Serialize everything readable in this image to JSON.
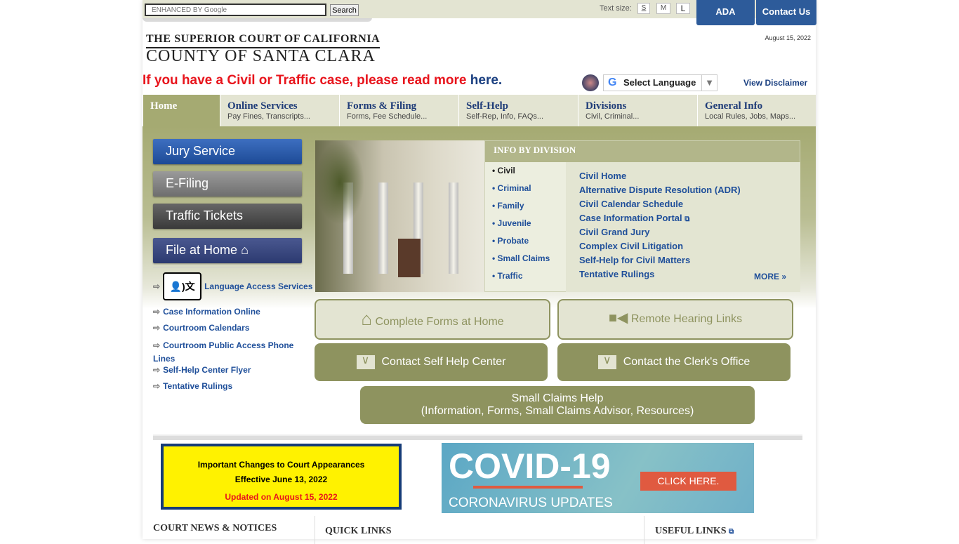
{
  "topbar": {
    "text_size_label": "Text size:",
    "sizes": [
      "S",
      "M",
      "L"
    ],
    "ada": "ADA",
    "contact": "Contact Us"
  },
  "header": {
    "logo_line1": "THE SUPERIOR COURT OF CALIFORNIA",
    "logo_line2": "COUNTY OF SANTA CLARA",
    "date": "August 15, 2022",
    "search_placeholder": "ENHANCED BY Google",
    "search_button": "Search",
    "alert_text": "If you have a Civil or Traffic case, please read more ",
    "alert_link": "here.",
    "language": "Select Language",
    "disclaimer": "View Disclaimer"
  },
  "nav": [
    {
      "title": "Home",
      "sub": ""
    },
    {
      "title": "Online Services",
      "sub": "Pay Fines, Transcripts..."
    },
    {
      "title": "Forms & Filing",
      "sub": "Forms, Fee Schedule..."
    },
    {
      "title": "Self-Help",
      "sub": "Self-Rep, Info, FAQs..."
    },
    {
      "title": "Divisions",
      "sub": "Civil, Criminal..."
    },
    {
      "title": "General Info",
      "sub": "Local Rules, Jobs, Maps..."
    }
  ],
  "left_buttons": [
    "Jury  Service",
    "E-Filing",
    "Traffic Tickets",
    "File at Home"
  ],
  "side_links": [
    "Language Access Services",
    "Case Information Online",
    "Courtroom Calendars",
    "Courtroom Public Access Phone Lines",
    "Self-Help Center Flyer",
    "Tentative Rulings"
  ],
  "info_by_division": {
    "title": "INFO BY DIVISION",
    "divisions": [
      "Civil",
      "Criminal",
      "Family",
      "Juvenile",
      "Probate",
      "Small Claims",
      "Traffic"
    ],
    "links": [
      "Civil Home",
      "Alternative Dispute Resolution (ADR)",
      "Civil Calendar Schedule",
      "Case Information Portal",
      "Civil Grand Jury",
      "Complex Civil Litigation",
      "Self-Help for Civil Matters",
      "Tentative Rulings"
    ],
    "more": "MORE »"
  },
  "action_buttons": {
    "forms": "Complete Forms at Home",
    "remote": "Remote Hearing Links",
    "selfhelp": "Contact Self Help Center",
    "clerk": "Contact the Clerk's Office",
    "small_claims_1": "Small Claims Help",
    "small_claims_2": "(Information, Forms, Small Claims Advisor, Resources)"
  },
  "banners": {
    "notice_1": "Important Changes to Court Appearances",
    "notice_2": "Effective June 13, 2022",
    "notice_3": "Updated on August 15, 2022",
    "covid_title": "COVID-19",
    "covid_sub": "CORONAVIRUS UPDATES",
    "covid_cta": "CLICK HERE."
  },
  "sections": {
    "news": "COURT NEWS & NOTICES",
    "quick": "QUICK LINKS",
    "useful": "USEFUL LINKS"
  }
}
